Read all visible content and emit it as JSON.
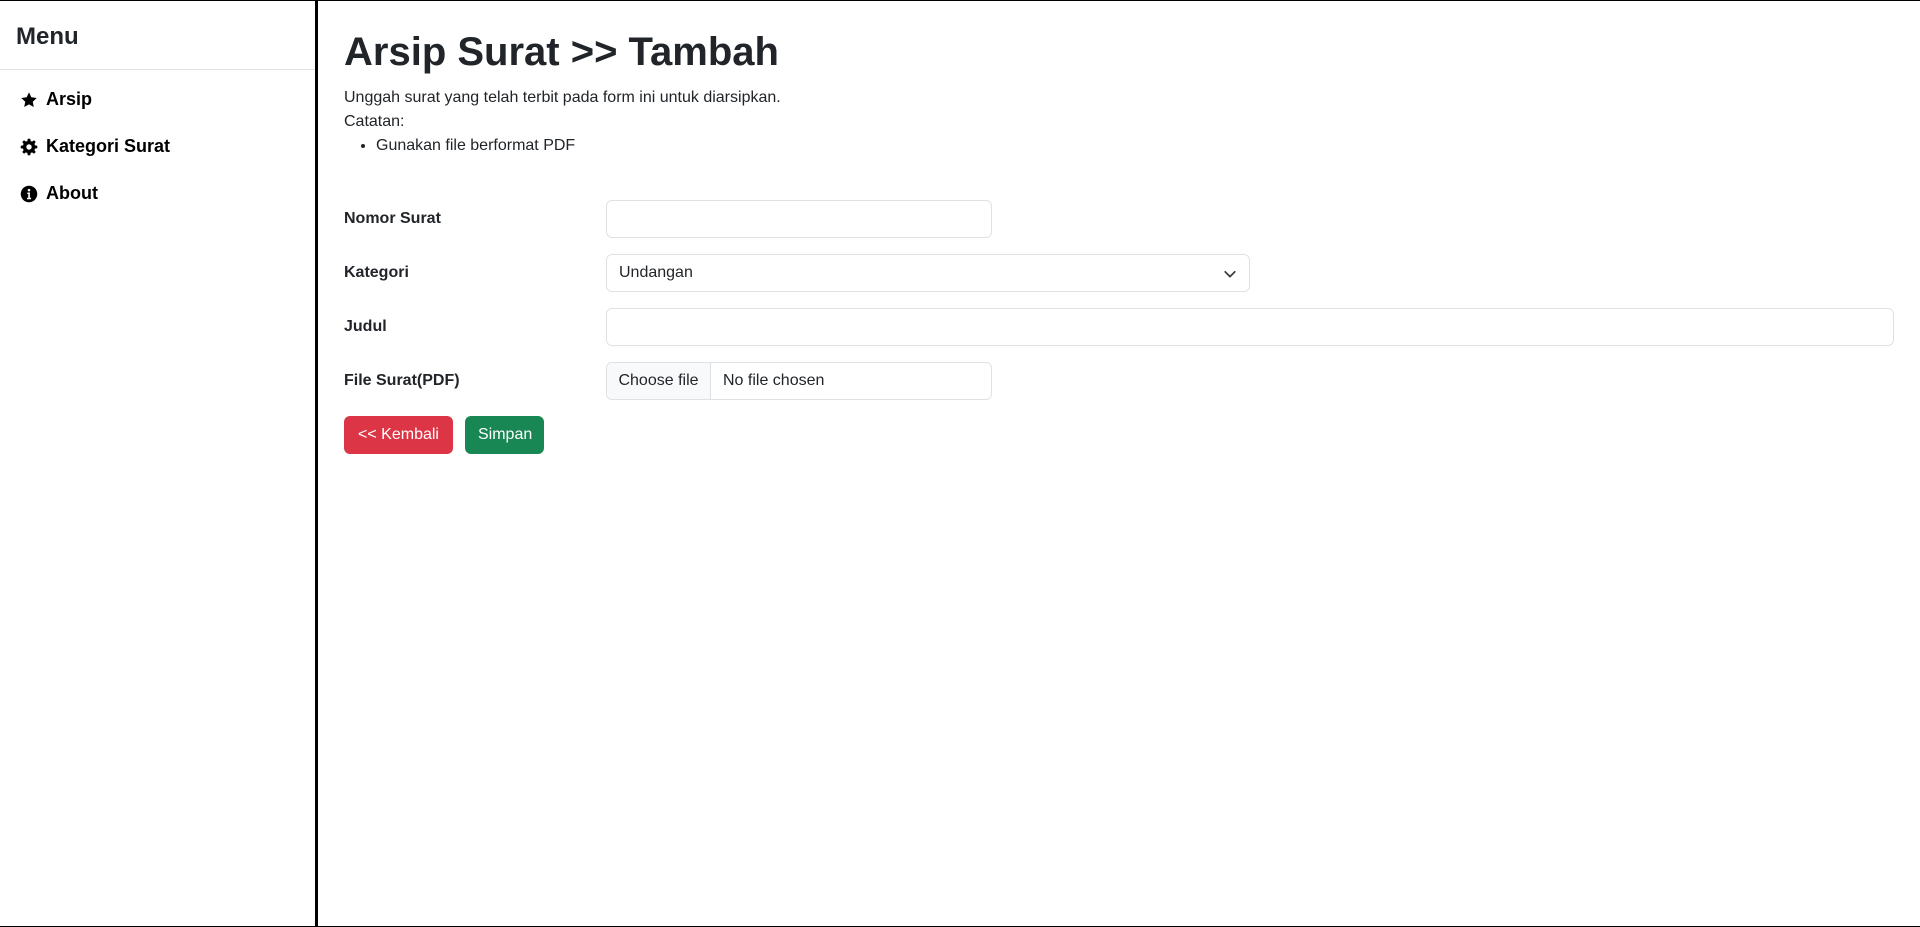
{
  "sidebar": {
    "title": "Menu",
    "items": [
      {
        "label": "Arsip",
        "icon": "star-icon"
      },
      {
        "label": "Kategori Surat",
        "icon": "gear-icon"
      },
      {
        "label": "About",
        "icon": "info-icon"
      }
    ]
  },
  "page": {
    "title": "Arsip Surat >> Tambah",
    "intro": "Unggah surat yang telah terbit pada form ini untuk diarsipkan.",
    "notes_label": "Catatan:",
    "notes": [
      "Gunakan file berformat PDF"
    ]
  },
  "form": {
    "nomor_surat": {
      "label": "Nomor Surat",
      "value": ""
    },
    "kategori": {
      "label": "Kategori",
      "selected": "Undangan"
    },
    "judul": {
      "label": "Judul",
      "value": ""
    },
    "file": {
      "label": "File Surat(PDF)",
      "button": "Choose file",
      "status": "No file chosen"
    }
  },
  "buttons": {
    "back": "<< Kembali",
    "save": "Simpan"
  },
  "colors": {
    "danger": "#dc3545",
    "success": "#198754",
    "border": "#dee2e6"
  }
}
